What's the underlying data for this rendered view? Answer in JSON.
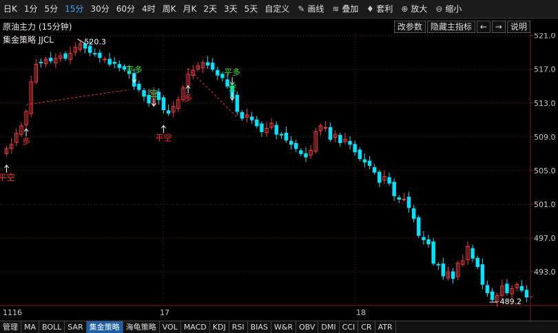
{
  "toolbar": {
    "items": [
      "日K",
      "1分",
      "5分",
      "15分",
      "30分",
      "60分",
      "4时",
      "周K",
      "月K",
      "2天",
      "3天",
      "5天",
      "自定义"
    ],
    "active_index": 3,
    "tools": [
      {
        "label": "画线",
        "icon": "pencil-icon"
      },
      {
        "label": "叠加",
        "icon": "layers-icon"
      },
      {
        "label": "套利",
        "icon": "bag-icon"
      },
      {
        "label": "放大",
        "icon": "zoom-in-icon"
      },
      {
        "label": "缩小",
        "icon": "zoom-out-icon"
      }
    ]
  },
  "info": {
    "title": "原油主力 (15分钟)",
    "buttons": [
      "改参数",
      "隐藏主指标",
      "←",
      "→",
      "说明"
    ]
  },
  "strategy_label": "集金策略 JJCL",
  "chart_data": {
    "type": "candlestick",
    "y_ticks": [
      "521.0",
      "517.0",
      "513.0",
      "509.0",
      "505.0",
      "501.0",
      "497.0",
      "493.0"
    ],
    "ylim": [
      489,
      521.3
    ],
    "x_labels": [
      "1116",
      "17",
      "18"
    ],
    "high_label": "520.3",
    "low_label": "489.2",
    "colors": {
      "up": "#ff3b3b",
      "down": "#00e5ff",
      "grid": "#7a1a1a",
      "axis": "#8b1a1a",
      "signal_up": "#ff3030",
      "signal_down": "#33dd33",
      "arrow": "#ffffff"
    },
    "signals": [
      {
        "label": "平空",
        "kind": "up"
      },
      {
        "label": "多",
        "kind": "up"
      },
      {
        "label": "平多",
        "kind": "down"
      },
      {
        "label": "空",
        "kind": "down"
      },
      {
        "label": "平空",
        "kind": "up"
      },
      {
        "label": "多",
        "kind": "up"
      },
      {
        "label": "平多",
        "kind": "down"
      },
      {
        "label": "空",
        "kind": "down"
      }
    ]
  },
  "bottom_tabs": [
    "管理",
    "MA",
    "BOLL",
    "SAR",
    "集金策略",
    "海龟策略",
    "VOL",
    "MACD",
    "KDJ",
    "RSI",
    "BIAS",
    "W&R",
    "OBV",
    "DMI",
    "CCI",
    "CR",
    "ATR"
  ],
  "bottom_active_index": 4
}
